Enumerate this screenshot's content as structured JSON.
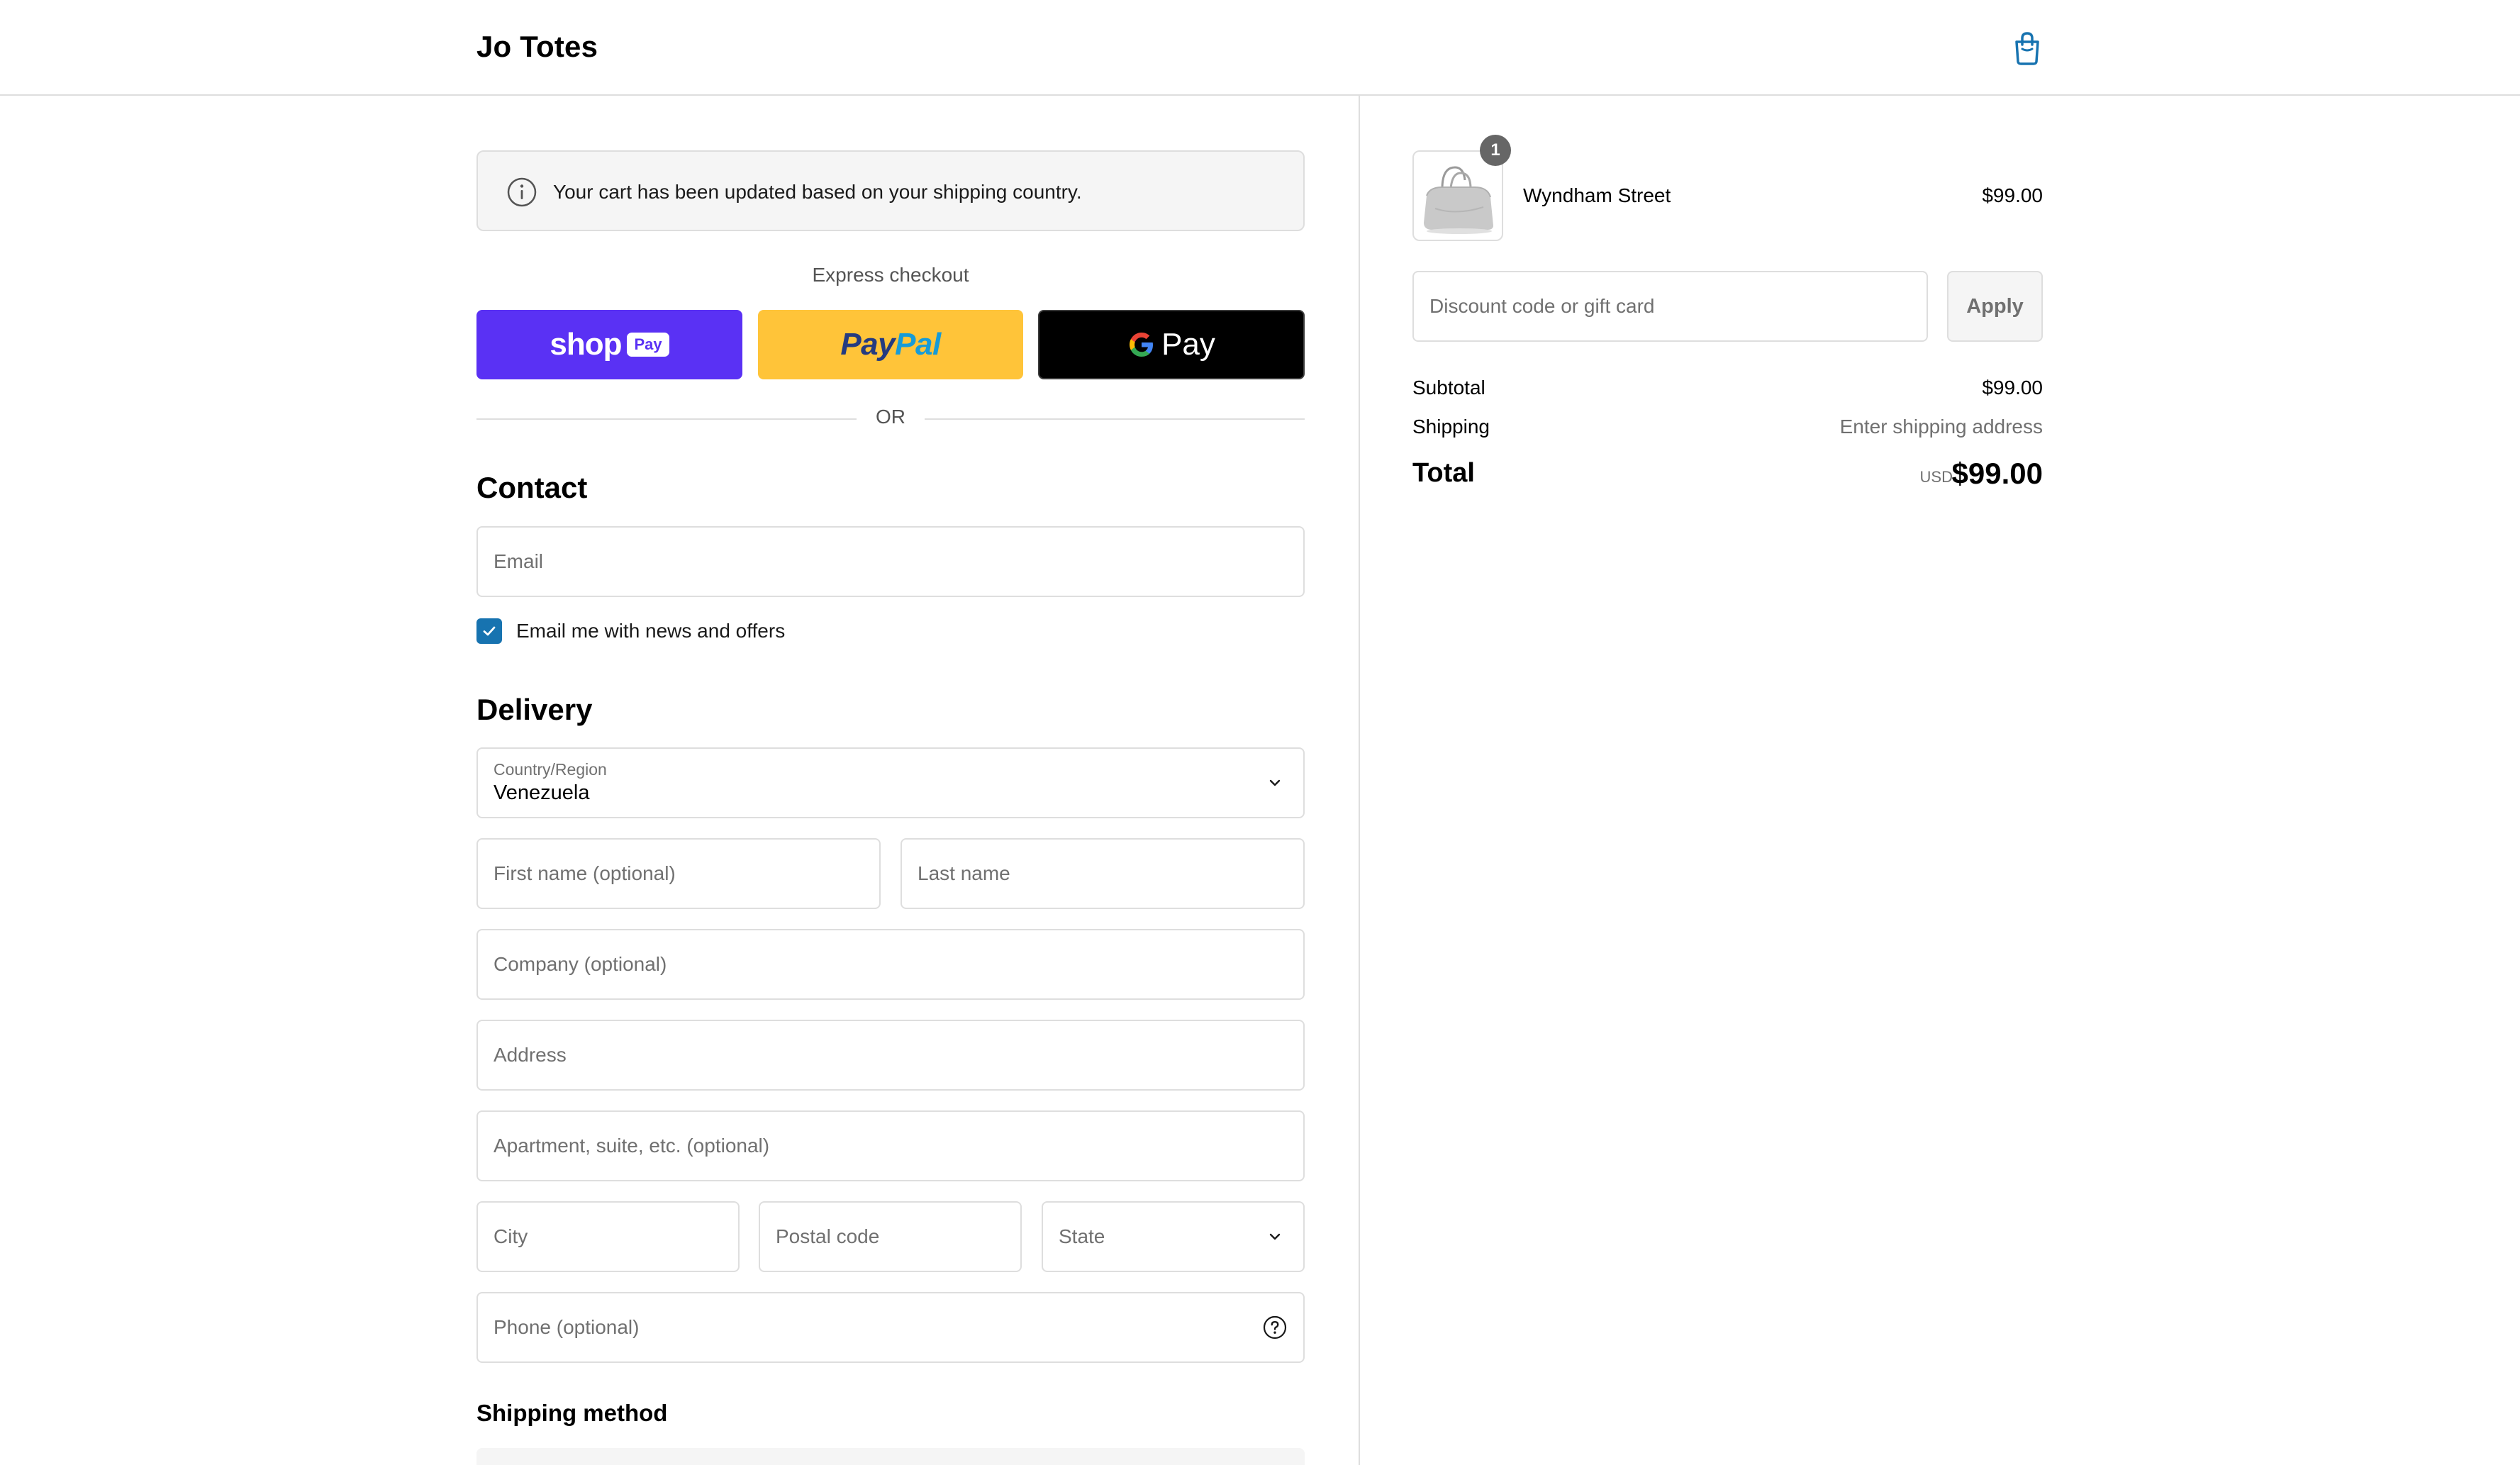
{
  "header": {
    "brand": "Jo Totes",
    "cart_icon": "shopping-bag-icon",
    "accent_color": "#1773b0"
  },
  "notice": {
    "icon": "info-icon",
    "text": "Your cart has been updated based on your shipping country."
  },
  "express": {
    "label": "Express checkout",
    "shop_pay": {
      "word": "shop",
      "pill": "Pay",
      "color": "#5a31f4"
    },
    "paypal": {
      "part1": "Pay",
      "part2": "Pal",
      "color": "#ffc439"
    },
    "gpay": {
      "word": "Pay",
      "color": "#000000"
    },
    "divider_text": "OR"
  },
  "contact": {
    "title": "Contact",
    "email_placeholder": "Email",
    "newsletter_label": "Email me with news and offers",
    "newsletter_checked": true
  },
  "delivery": {
    "title": "Delivery",
    "country_label": "Country/Region",
    "country_value": "Venezuela",
    "first_name_placeholder": "First name (optional)",
    "last_name_placeholder": "Last name",
    "company_placeholder": "Company (optional)",
    "address_placeholder": "Address",
    "apartment_placeholder": "Apartment, suite, etc. (optional)",
    "city_placeholder": "City",
    "postal_placeholder": "Postal code",
    "state_placeholder": "State",
    "phone_placeholder": "Phone (optional)"
  },
  "shipping_method": {
    "title": "Shipping method"
  },
  "summary": {
    "item": {
      "name": "Wyndham Street",
      "price": "$99.00",
      "quantity": "1",
      "image_icon": "tote-bag-product-image"
    },
    "discount_placeholder": "Discount code or gift card",
    "apply_label": "Apply",
    "subtotal_label": "Subtotal",
    "subtotal_value": "$99.00",
    "shipping_label": "Shipping",
    "shipping_value": "Enter shipping address",
    "total_label": "Total",
    "currency": "USD",
    "total_value": "$99.00"
  }
}
